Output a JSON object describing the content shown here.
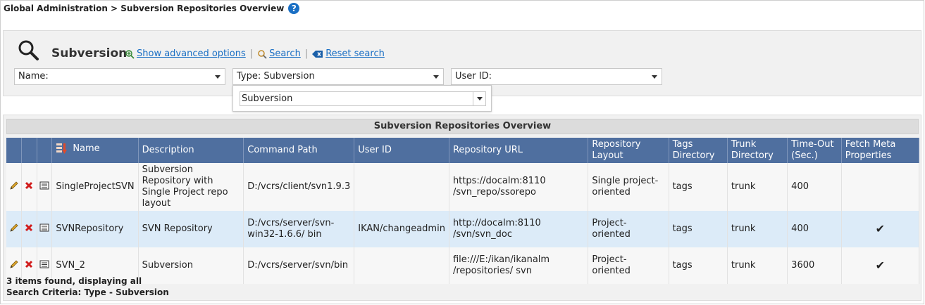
{
  "breadcrumb": "Global Administration > Subversion Repositories Overview",
  "search": {
    "title": "Subversion",
    "show_advanced_label": "Show advanced options",
    "search_label": "Search",
    "reset_label": "Reset search",
    "name_filter": "Name:",
    "type_filter": "Type: Subversion",
    "userid_filter": "User ID:",
    "type_dropdown_value": "Subversion"
  },
  "results": {
    "title": "Subversion Repositories Overview",
    "columns": [
      "Name",
      "Description",
      "Command Path",
      "User ID",
      "Repository URL",
      "Repository Layout",
      "Tags Directory",
      "Trunk Directory",
      "Time-Out (Sec.)",
      "Fetch Meta Properties"
    ],
    "rows": [
      {
        "name": "SingleProjectSVN",
        "description": "Subversion Repository with Single Project repo layout",
        "command_path": "D:/vcrs/client/svn1.9.3",
        "user_id": "",
        "repository_url": "https://docalm:8110 /svn_repo/ssorepo",
        "layout": "Single project-oriented",
        "tags": "tags",
        "trunk": "trunk",
        "timeout": "400",
        "fetch_meta": ""
      },
      {
        "name": "SVNRepository",
        "description": "SVN Repository",
        "command_path": "D:/vcrs/server/svn-win32-1.6.6/ bin",
        "user_id": "IKAN/changeadmin",
        "repository_url": "http://docalm:8110 /svn/svn_doc",
        "layout": "Project-oriented",
        "tags": "tags",
        "trunk": "trunk",
        "timeout": "400",
        "fetch_meta": "✔"
      },
      {
        "name": "SVN_2",
        "description": "Subversion",
        "command_path": "D:/vcrs/server/svn/bin",
        "user_id": "",
        "repository_url": "file:///E:/ikan/ikanalm /repositories/ svn",
        "layout": "Project-oriented",
        "tags": "tags",
        "trunk": "trunk",
        "timeout": "3600",
        "fetch_meta": "✔"
      }
    ],
    "footer_count": "3 items found, displaying all",
    "footer_criteria": "Search Criteria: Type - Subversion"
  },
  "colors": {
    "header_bg": "#4f6f9f",
    "row_highlight": "#dcebf8",
    "link": "#1a6fc4",
    "check": "#d11c1c"
  }
}
